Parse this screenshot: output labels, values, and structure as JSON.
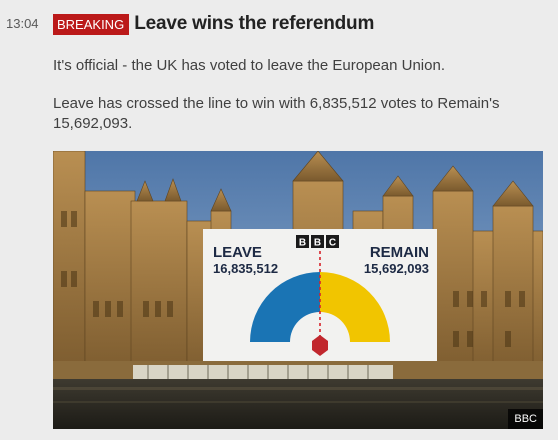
{
  "entry": {
    "time": "13:04",
    "badge": "BREAKING",
    "title": "Leave wins the referendum",
    "paragraph_1": "It's official - the UK has voted to leave the European Union.",
    "paragraph_2": "Leave has crossed the line to win with 6,835,512 votes to Remain's 15,692,093."
  },
  "image": {
    "credit": "BBC",
    "board": {
      "logo": "BBC",
      "leave_label": "LEAVE",
      "leave_votes": "16,835,512",
      "remain_label": "REMAIN",
      "remain_votes": "15,692,093"
    }
  },
  "colors": {
    "badge_bg": "#bb1919",
    "leave": "#1a74b4",
    "remain": "#f1c500"
  }
}
